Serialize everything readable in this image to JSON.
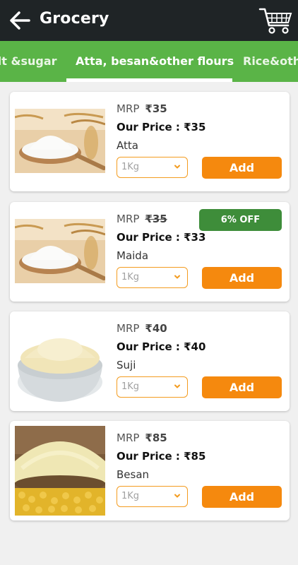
{
  "header": {
    "title": "Grocery",
    "back_icon": "arrow-left-icon",
    "cart_icon": "shopping-cart-icon",
    "bg_color": "#1f2426"
  },
  "tabs": {
    "items": [
      {
        "label": "alt &sugar"
      },
      {
        "label": "Atta, besan&other flours"
      },
      {
        "label": "Rice&oth"
      }
    ],
    "selected_index": 1,
    "bg_color": "#5ab447"
  },
  "products": [
    {
      "mrp_label": "MRP",
      "mrp": "₹35",
      "mrp_struck": false,
      "our_price": "Our Price : ₹35",
      "name": "Atta",
      "quantity": "1Kg",
      "add_label": "Add",
      "discount": ""
    },
    {
      "mrp_label": "MRP",
      "mrp": "₹35",
      "mrp_struck": true,
      "our_price": "Our Price : ₹33",
      "name": "Maida",
      "quantity": "1Kg",
      "add_label": "Add",
      "discount": "6% OFF"
    },
    {
      "mrp_label": "MRP",
      "mrp": "₹40",
      "mrp_struck": false,
      "our_price": "Our Price : ₹40",
      "name": "Suji",
      "quantity": "1Kg",
      "add_label": "Add",
      "discount": ""
    },
    {
      "mrp_label": "MRP",
      "mrp": "₹85",
      "mrp_struck": false,
      "our_price": "Our Price : ₹85",
      "name": "Besan",
      "quantity": "1Kg",
      "add_label": "Add",
      "discount": ""
    }
  ],
  "colors": {
    "accent_orange": "#f5890e",
    "discount_green": "#3e8d3a"
  }
}
